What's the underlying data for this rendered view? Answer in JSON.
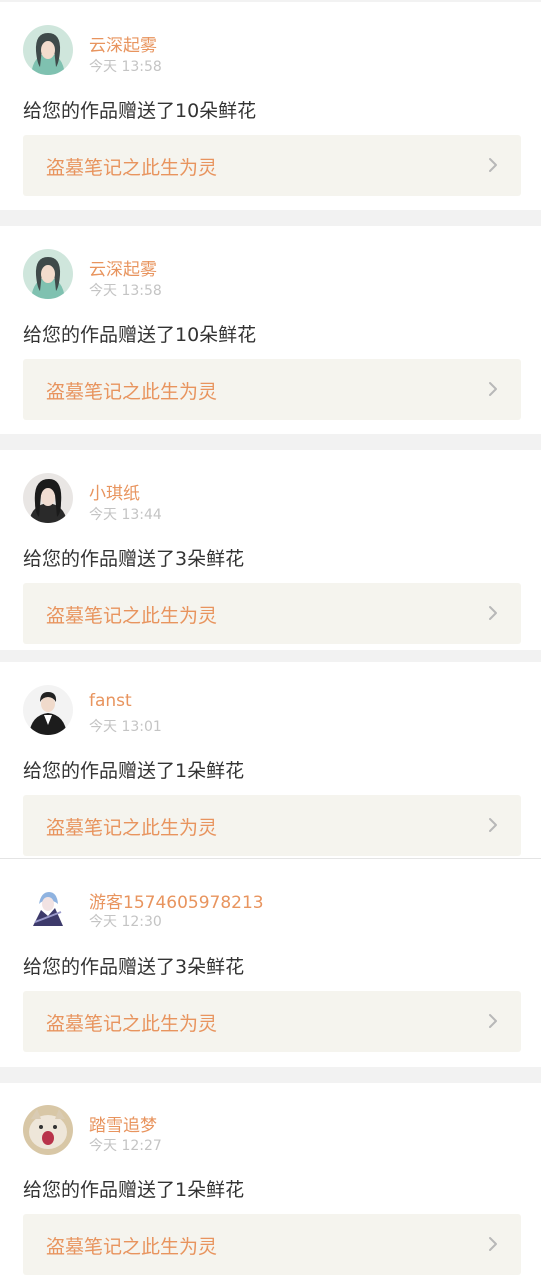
{
  "notifications": [
    {
      "username": "云深起雾",
      "time": "今天 13:58",
      "message": "给您的作品赠送了10朵鲜花",
      "work_title": "盗墓笔记之此生为灵",
      "avatar_icon": "anime-girl-teal-avatar"
    },
    {
      "username": "云深起雾",
      "time": "今天 13:58",
      "message": "给您的作品赠送了10朵鲜花",
      "work_title": "盗墓笔记之此生为灵",
      "avatar_icon": "anime-girl-teal-avatar"
    },
    {
      "username": "小琪纸",
      "time": "今天 13:44",
      "message": "给您的作品赠送了3朵鲜花",
      "work_title": "盗墓笔记之此生为灵",
      "avatar_icon": "dark-hair-girl-avatar"
    },
    {
      "username": "fanst",
      "time": "今天 13:01",
      "message": "给您的作品赠送了1朵鲜花",
      "work_title": "盗墓笔记之此生为灵",
      "avatar_icon": "boy-in-suit-avatar"
    },
    {
      "username": "游客1574605978213",
      "time": "今天 12:30",
      "message": "给您的作品赠送了3朵鲜花",
      "work_title": "盗墓笔记之此生为灵",
      "avatar_icon": "anime-character-purple-avatar"
    },
    {
      "username": "踏雪追梦",
      "time": "今天 12:27",
      "message": "给您的作品赠送了1朵鲜花",
      "work_title": "盗墓笔记之此生为灵",
      "avatar_icon": "screaming-cat-avatar"
    }
  ],
  "colors": {
    "accent": "#e8945e",
    "timestamp": "#c4c4c4",
    "link_background": "#f5f4ee",
    "page_background": "#f2f2f2",
    "text": "#333333"
  }
}
